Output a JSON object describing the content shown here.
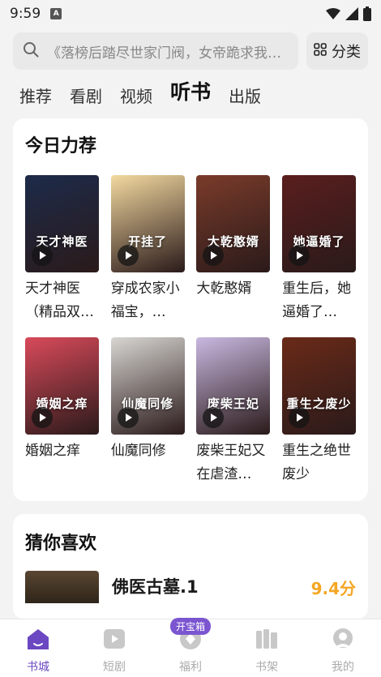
{
  "status_bar": {
    "time": "9:59",
    "app_badge": "A"
  },
  "search": {
    "placeholder": "《落榜后踏尽世家门阀，女帝跪求我…",
    "category_label": "分类"
  },
  "tabs": [
    {
      "label": "推荐",
      "active": false
    },
    {
      "label": "看剧",
      "active": false
    },
    {
      "label": "视频",
      "active": false
    },
    {
      "label": "听书",
      "active": true
    },
    {
      "label": "出版",
      "active": false
    }
  ],
  "recommend": {
    "title": "今日力荐",
    "books": [
      {
        "name": "天才神医（精品双…",
        "cover_text": "天才神医",
        "cover_color": "#1d2b4a"
      },
      {
        "name": "穿成农家小福宝，…",
        "cover_text": "开挂了",
        "cover_color": "#f3d9a0"
      },
      {
        "name": "大乾憨婿",
        "cover_text": "大乾憨婿",
        "cover_color": "#7a3b2a"
      },
      {
        "name": "重生后，她逼婚了…",
        "cover_text": "她逼婚了",
        "cover_color": "#5a1e1e"
      },
      {
        "name": "婚姻之痒",
        "cover_text": "婚姻之痒",
        "cover_color": "#d94a5a"
      },
      {
        "name": "仙魔同修",
        "cover_text": "仙魔同修",
        "cover_color": "#d8d6d2"
      },
      {
        "name": "废柴王妃又在虐渣…",
        "cover_text": "废柴王妃",
        "cover_color": "#c9b8e0"
      },
      {
        "name": "重生之绝世废少",
        "cover_text": "重生之废少",
        "cover_color": "#6a2a18"
      }
    ]
  },
  "guess": {
    "title": "猜你喜欢",
    "item": {
      "name": "佛医古墓.1",
      "score": "9.4分"
    }
  },
  "bottom_nav": [
    {
      "label": "书城",
      "active": true,
      "icon": "home-icon"
    },
    {
      "label": "短剧",
      "active": false,
      "icon": "video-icon"
    },
    {
      "label": "福利",
      "active": false,
      "icon": "gift-icon",
      "badge": "开宝箱"
    },
    {
      "label": "书架",
      "active": false,
      "icon": "bookshelf-icon"
    },
    {
      "label": "我的",
      "active": false,
      "icon": "profile-icon"
    }
  ],
  "colors": {
    "accent": "#6b47c1",
    "score": "#f5a623"
  }
}
